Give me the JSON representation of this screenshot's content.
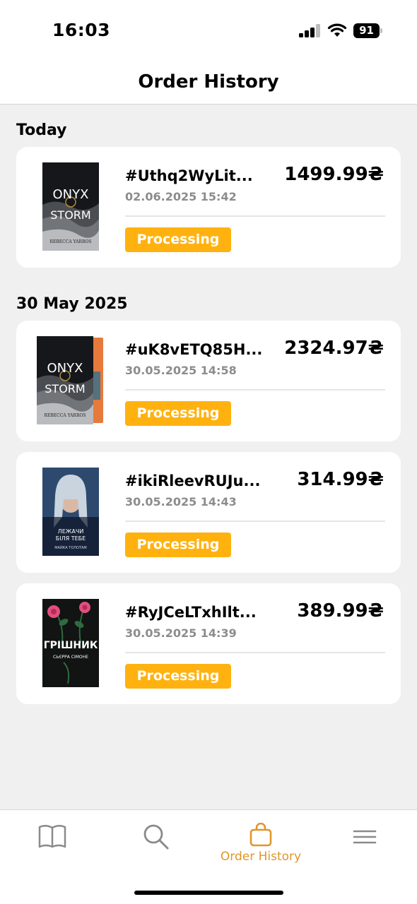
{
  "status_bar": {
    "time": "16:03",
    "battery": "91"
  },
  "header": {
    "title": "Order History"
  },
  "sections": [
    {
      "title": "Today",
      "orders": [
        {
          "id": "#Uthq2WyLit...",
          "date": "02.06.2025 15:42",
          "price": "1499.99₴",
          "status": "Processing",
          "cover": {
            "title_line1": "ONYX",
            "title_line2": "STORM",
            "author": "REBECCA YARROS"
          }
        }
      ]
    },
    {
      "title": "30 May 2025",
      "orders": [
        {
          "id": "#uK8vETQ85H...",
          "date": "30.05.2025 14:58",
          "price": "2324.97₴",
          "status": "Processing",
          "cover": {
            "title_line1": "ONYX",
            "title_line2": "STORM",
            "author": "REBECCA YARROS"
          }
        },
        {
          "id": "#ikiRleevRUJu...",
          "date": "30.05.2025 14:43",
          "price": "314.99₴",
          "status": "Processing",
          "cover": {
            "title_line1": "ЛЕЖАЧИ",
            "title_line2": "БІЛЯ ТЕБЕ",
            "author": "МАЙКА ТОЛОТАМ"
          }
        },
        {
          "id": "#RyJCeLTxhIlt...",
          "date": "30.05.2025 14:39",
          "price": "389.99₴",
          "status": "Processing",
          "cover": {
            "title_line1": "ГРІШНИК",
            "title_line2": "СЬЄРРА СІМОНЕ"
          }
        }
      ]
    }
  ],
  "tabbar": {
    "items": [
      {
        "icon": "book-icon",
        "label": ""
      },
      {
        "icon": "search-icon",
        "label": ""
      },
      {
        "icon": "shopping-bag-icon",
        "label": "Order History",
        "active": true
      },
      {
        "icon": "menu-icon",
        "label": ""
      }
    ]
  },
  "colors": {
    "accent": "#ffb20f",
    "active_tab": "#e0962a",
    "background": "#f0f0f0"
  }
}
